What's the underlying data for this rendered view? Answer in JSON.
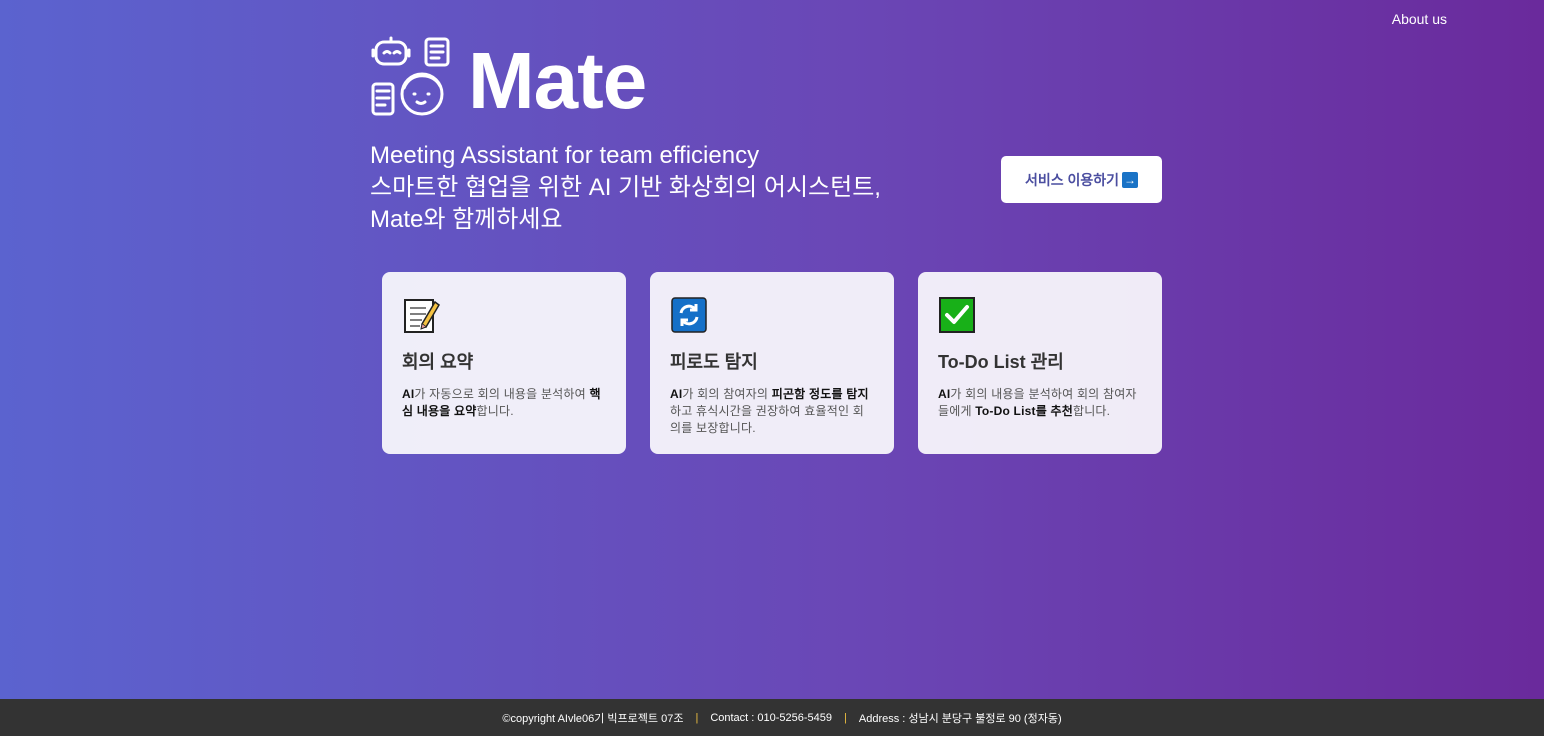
{
  "nav": {
    "about_label": "About us"
  },
  "hero": {
    "brand": "Mate",
    "tagline_line1": "Meeting Assistant for team efficiency",
    "tagline_line2": "스마트한 협업을 위한 AI 기반 화상회의 어시스턴트,",
    "tagline_line3": "Mate와 함께하세요",
    "cta_label": "서비스 이용하기",
    "cta_icon": "arrow-right-icon"
  },
  "features": [
    {
      "icon": "memo-icon",
      "title": "회의 요약",
      "desc_parts": [
        "AI",
        "가 자동으로 회의 내용을 분석하여 ",
        "핵심 내용을 요약",
        "합니다."
      ]
    },
    {
      "icon": "refresh-icon",
      "title": "피로도 탐지",
      "desc_parts": [
        "AI",
        "가 회의 참여자의 ",
        "피곤함 정도를 탐지",
        "하고 휴식시간을 권장하여 효율적인 회의를 보장합니다."
      ]
    },
    {
      "icon": "check-icon",
      "title": "To-Do List 관리",
      "desc_parts": [
        "AI",
        "가 회의 내용을 분석하여 회의 참여자들에게 ",
        "To-Do List를 추천",
        "합니다."
      ]
    }
  ],
  "footer": {
    "copyright": "©copyright AIvle06기 빅프로젝트 07조",
    "contact": "Contact : 010-5256-5459",
    "address": "Address : 성남시 분당구 불정로 90 (정자동)",
    "separator": "|"
  },
  "colors": {
    "gradient_start": "#5b63cf",
    "gradient_end": "#6a2a9c",
    "footer_bg": "#333333",
    "cta_text": "#4b4ea0"
  }
}
